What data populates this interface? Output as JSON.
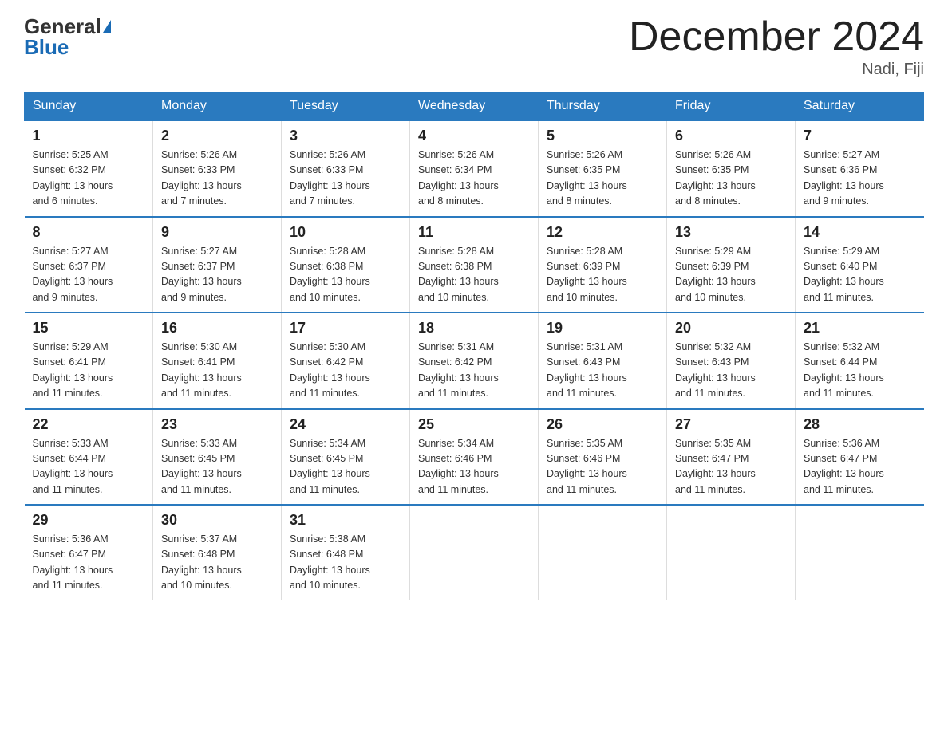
{
  "header": {
    "logo_general": "General",
    "logo_blue": "Blue",
    "title": "December 2024",
    "location": "Nadi, Fiji"
  },
  "days_of_week": [
    "Sunday",
    "Monday",
    "Tuesday",
    "Wednesday",
    "Thursday",
    "Friday",
    "Saturday"
  ],
  "weeks": [
    [
      {
        "day": "1",
        "info": "Sunrise: 5:25 AM\nSunset: 6:32 PM\nDaylight: 13 hours\nand 6 minutes."
      },
      {
        "day": "2",
        "info": "Sunrise: 5:26 AM\nSunset: 6:33 PM\nDaylight: 13 hours\nand 7 minutes."
      },
      {
        "day": "3",
        "info": "Sunrise: 5:26 AM\nSunset: 6:33 PM\nDaylight: 13 hours\nand 7 minutes."
      },
      {
        "day": "4",
        "info": "Sunrise: 5:26 AM\nSunset: 6:34 PM\nDaylight: 13 hours\nand 8 minutes."
      },
      {
        "day": "5",
        "info": "Sunrise: 5:26 AM\nSunset: 6:35 PM\nDaylight: 13 hours\nand 8 minutes."
      },
      {
        "day": "6",
        "info": "Sunrise: 5:26 AM\nSunset: 6:35 PM\nDaylight: 13 hours\nand 8 minutes."
      },
      {
        "day": "7",
        "info": "Sunrise: 5:27 AM\nSunset: 6:36 PM\nDaylight: 13 hours\nand 9 minutes."
      }
    ],
    [
      {
        "day": "8",
        "info": "Sunrise: 5:27 AM\nSunset: 6:37 PM\nDaylight: 13 hours\nand 9 minutes."
      },
      {
        "day": "9",
        "info": "Sunrise: 5:27 AM\nSunset: 6:37 PM\nDaylight: 13 hours\nand 9 minutes."
      },
      {
        "day": "10",
        "info": "Sunrise: 5:28 AM\nSunset: 6:38 PM\nDaylight: 13 hours\nand 10 minutes."
      },
      {
        "day": "11",
        "info": "Sunrise: 5:28 AM\nSunset: 6:38 PM\nDaylight: 13 hours\nand 10 minutes."
      },
      {
        "day": "12",
        "info": "Sunrise: 5:28 AM\nSunset: 6:39 PM\nDaylight: 13 hours\nand 10 minutes."
      },
      {
        "day": "13",
        "info": "Sunrise: 5:29 AM\nSunset: 6:39 PM\nDaylight: 13 hours\nand 10 minutes."
      },
      {
        "day": "14",
        "info": "Sunrise: 5:29 AM\nSunset: 6:40 PM\nDaylight: 13 hours\nand 11 minutes."
      }
    ],
    [
      {
        "day": "15",
        "info": "Sunrise: 5:29 AM\nSunset: 6:41 PM\nDaylight: 13 hours\nand 11 minutes."
      },
      {
        "day": "16",
        "info": "Sunrise: 5:30 AM\nSunset: 6:41 PM\nDaylight: 13 hours\nand 11 minutes."
      },
      {
        "day": "17",
        "info": "Sunrise: 5:30 AM\nSunset: 6:42 PM\nDaylight: 13 hours\nand 11 minutes."
      },
      {
        "day": "18",
        "info": "Sunrise: 5:31 AM\nSunset: 6:42 PM\nDaylight: 13 hours\nand 11 minutes."
      },
      {
        "day": "19",
        "info": "Sunrise: 5:31 AM\nSunset: 6:43 PM\nDaylight: 13 hours\nand 11 minutes."
      },
      {
        "day": "20",
        "info": "Sunrise: 5:32 AM\nSunset: 6:43 PM\nDaylight: 13 hours\nand 11 minutes."
      },
      {
        "day": "21",
        "info": "Sunrise: 5:32 AM\nSunset: 6:44 PM\nDaylight: 13 hours\nand 11 minutes."
      }
    ],
    [
      {
        "day": "22",
        "info": "Sunrise: 5:33 AM\nSunset: 6:44 PM\nDaylight: 13 hours\nand 11 minutes."
      },
      {
        "day": "23",
        "info": "Sunrise: 5:33 AM\nSunset: 6:45 PM\nDaylight: 13 hours\nand 11 minutes."
      },
      {
        "day": "24",
        "info": "Sunrise: 5:34 AM\nSunset: 6:45 PM\nDaylight: 13 hours\nand 11 minutes."
      },
      {
        "day": "25",
        "info": "Sunrise: 5:34 AM\nSunset: 6:46 PM\nDaylight: 13 hours\nand 11 minutes."
      },
      {
        "day": "26",
        "info": "Sunrise: 5:35 AM\nSunset: 6:46 PM\nDaylight: 13 hours\nand 11 minutes."
      },
      {
        "day": "27",
        "info": "Sunrise: 5:35 AM\nSunset: 6:47 PM\nDaylight: 13 hours\nand 11 minutes."
      },
      {
        "day": "28",
        "info": "Sunrise: 5:36 AM\nSunset: 6:47 PM\nDaylight: 13 hours\nand 11 minutes."
      }
    ],
    [
      {
        "day": "29",
        "info": "Sunrise: 5:36 AM\nSunset: 6:47 PM\nDaylight: 13 hours\nand 11 minutes."
      },
      {
        "day": "30",
        "info": "Sunrise: 5:37 AM\nSunset: 6:48 PM\nDaylight: 13 hours\nand 10 minutes."
      },
      {
        "day": "31",
        "info": "Sunrise: 5:38 AM\nSunset: 6:48 PM\nDaylight: 13 hours\nand 10 minutes."
      },
      {
        "day": "",
        "info": ""
      },
      {
        "day": "",
        "info": ""
      },
      {
        "day": "",
        "info": ""
      },
      {
        "day": "",
        "info": ""
      }
    ]
  ]
}
